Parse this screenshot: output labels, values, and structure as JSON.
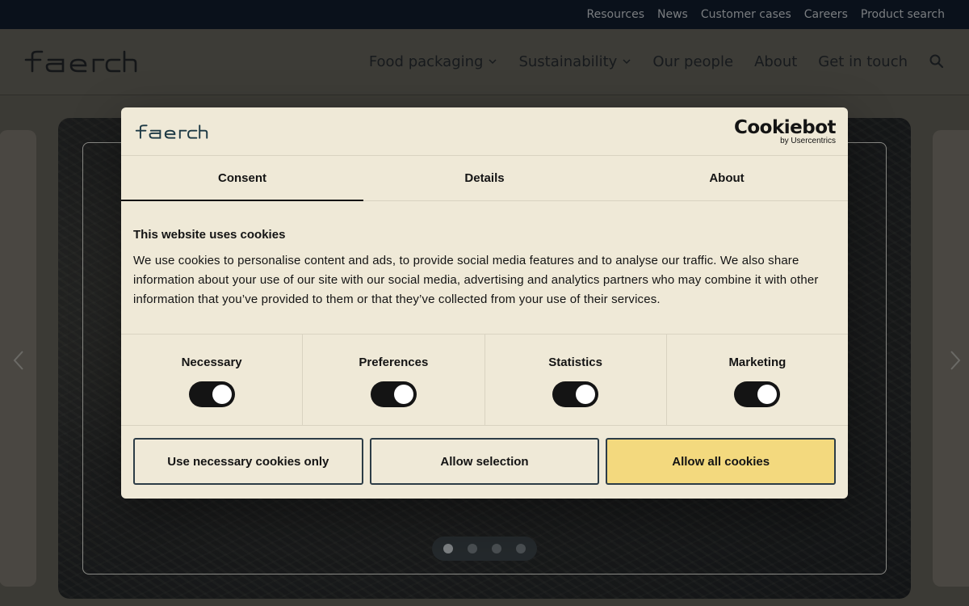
{
  "topbar": {
    "links": [
      "Resources",
      "News",
      "Customer cases",
      "Careers",
      "Product search"
    ]
  },
  "header": {
    "logo": "faerch",
    "nav": [
      {
        "label": "Food packaging",
        "has_dropdown": true
      },
      {
        "label": "Sustainability",
        "has_dropdown": true
      },
      {
        "label": "Our people",
        "has_dropdown": false
      },
      {
        "label": "About",
        "has_dropdown": false
      },
      {
        "label": "Get in touch",
        "has_dropdown": false
      }
    ],
    "search_icon": "search-icon"
  },
  "hero": {
    "slides_count": 4,
    "active_slide": 1
  },
  "cookie_dialog": {
    "logo": "faerch",
    "brand_name": "Cookiebot",
    "brand_sub": "by Usercentrics",
    "tabs": [
      {
        "label": "Consent",
        "active": true
      },
      {
        "label": "Details",
        "active": false
      },
      {
        "label": "About",
        "active": false
      }
    ],
    "title": "This website uses cookies",
    "text": "We use cookies to personalise content and ads, to provide social media features and to analyse our traffic. We also share information about your use of our site with our social media, advertising and analytics partners who may combine it with other information that you’ve provided to them or that they’ve collected from your use of their services.",
    "toggles": [
      {
        "label": "Necessary",
        "on": true
      },
      {
        "label": "Preferences",
        "on": true
      },
      {
        "label": "Statistics",
        "on": true
      },
      {
        "label": "Marketing",
        "on": true
      }
    ],
    "buttons": {
      "necessary_only": "Use necessary cookies only",
      "allow_selection": "Allow selection",
      "allow_all": "Allow all cookies"
    },
    "colors": {
      "background": "#efe9d7",
      "primary_button": "#f3d97e",
      "button_border": "#2c3c46"
    }
  }
}
